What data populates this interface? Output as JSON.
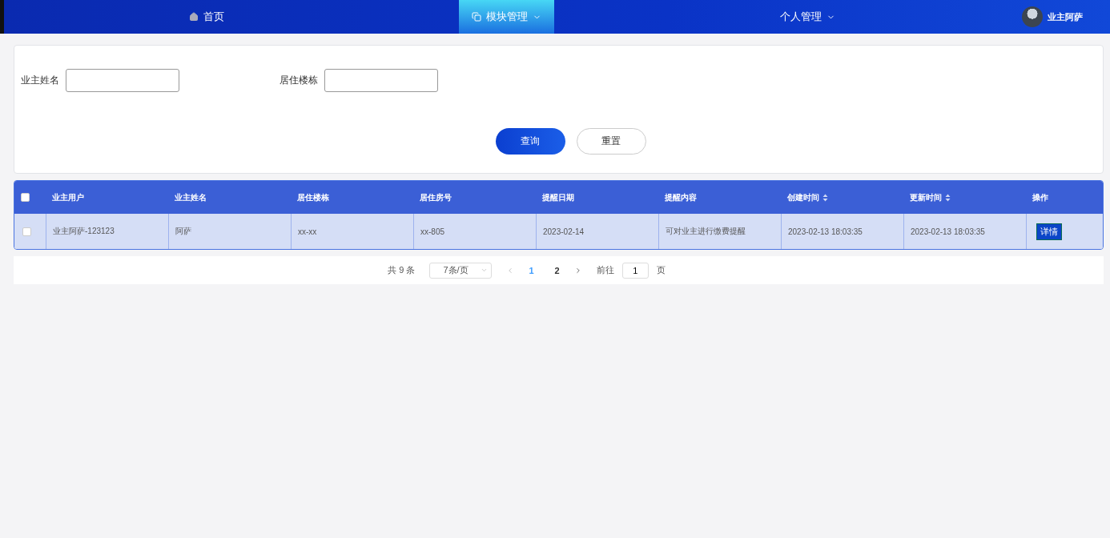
{
  "nav": {
    "items": [
      {
        "label": "首页",
        "selected": false,
        "dropdown": false
      },
      {
        "label": "模块管理",
        "selected": true,
        "dropdown": true
      },
      {
        "label": "个人管理",
        "selected": false,
        "dropdown": true
      }
    ],
    "user": {
      "name": "业主阿萨"
    }
  },
  "search": {
    "fields": [
      {
        "label": "业主姓名"
      },
      {
        "label": "居住楼栋"
      }
    ],
    "buttons": [
      {
        "label": "查询",
        "kind": "primary"
      },
      {
        "label": "重置",
        "kind": "plain"
      }
    ]
  },
  "table": {
    "select_all_checked": false,
    "columns": [
      {
        "label": "业主用户",
        "sortable": false
      },
      {
        "label": "业主姓名",
        "sortable": false
      },
      {
        "label": "居住楼栋",
        "sortable": false
      },
      {
        "label": "居住房号",
        "sortable": false
      },
      {
        "label": "提醒日期",
        "sortable": false
      },
      {
        "label": "提醒内容",
        "sortable": false
      },
      {
        "label": "创建时间",
        "sortable": true
      },
      {
        "label": "更新时间",
        "sortable": true
      },
      {
        "label": "操作",
        "sortable": false
      }
    ],
    "rows": [
      {
        "selected": true,
        "checked": false,
        "cells": [
          "业主阿萨-123123",
          "阿萨",
          "xx-xx",
          "xx-805",
          "2023-02-14",
          "可对业主进行缴费提醒",
          "2023-02-13 18:03:35",
          "2023-02-13 18:03:35"
        ],
        "action": "详情"
      }
    ]
  },
  "pagination": {
    "total": "共 9 条",
    "page_size": "7条/页",
    "pages": [
      {
        "label": "1",
        "selected": true
      },
      {
        "label": "2",
        "selected": false
      }
    ],
    "goto_label": "前往",
    "goto_value": "1",
    "page_suffix": "页"
  }
}
